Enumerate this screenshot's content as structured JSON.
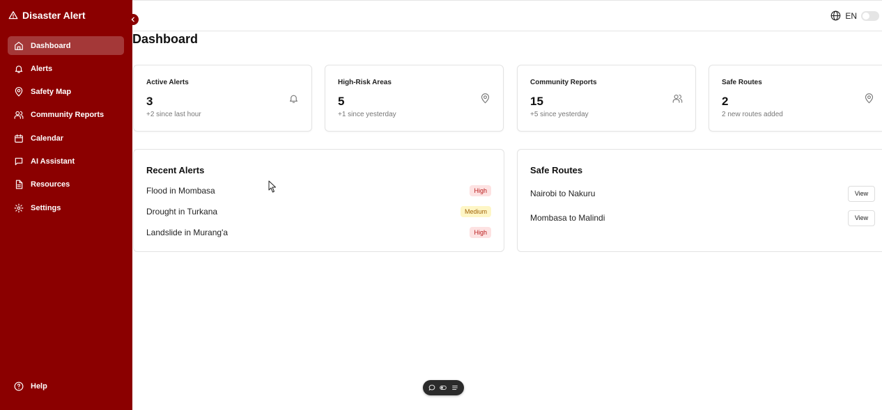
{
  "app": {
    "title": "Disaster Alert"
  },
  "sidebar": {
    "items": [
      {
        "label": "Dashboard",
        "icon": "home-icon",
        "active": true
      },
      {
        "label": "Alerts",
        "icon": "bell-icon"
      },
      {
        "label": "Safety Map",
        "icon": "map-pin-icon"
      },
      {
        "label": "Community Reports",
        "icon": "users-icon"
      },
      {
        "label": "Calendar",
        "icon": "calendar-icon"
      },
      {
        "label": "AI Assistant",
        "icon": "chat-icon"
      },
      {
        "label": "Resources",
        "icon": "document-icon"
      },
      {
        "label": "Settings",
        "icon": "gear-icon"
      }
    ],
    "help_label": "Help"
  },
  "topbar": {
    "language": "EN"
  },
  "page": {
    "title": "Dashboard"
  },
  "stats": [
    {
      "title": "Active Alerts",
      "value": "3",
      "sub": "+2 since last hour",
      "icon": "bell-icon"
    },
    {
      "title": "High-Risk Areas",
      "value": "5",
      "sub": "+1 since yesterday",
      "icon": "map-pin-icon"
    },
    {
      "title": "Community Reports",
      "value": "15",
      "sub": "+5 since yesterday",
      "icon": "users-icon"
    },
    {
      "title": "Safe Routes",
      "value": "2",
      "sub": "2 new routes added",
      "icon": "map-pin-icon"
    }
  ],
  "recent_alerts": {
    "title": "Recent Alerts",
    "items": [
      {
        "name": "Flood in Mombasa",
        "severity": "High"
      },
      {
        "name": "Drought in Turkana",
        "severity": "Medium"
      },
      {
        "name": "Landslide in Murang'a",
        "severity": "High"
      }
    ]
  },
  "safe_routes": {
    "title": "Safe Routes",
    "view_label": "View",
    "items": [
      {
        "name": "Nairobi to Nakuru"
      },
      {
        "name": "Mombasa to Malindi"
      }
    ]
  },
  "colors": {
    "sidebar": "#8b0000",
    "badge_high_bg": "#fde2e2",
    "badge_high_text": "#b91c1c",
    "badge_medium_bg": "#fef6c6",
    "badge_medium_text": "#a16207"
  }
}
